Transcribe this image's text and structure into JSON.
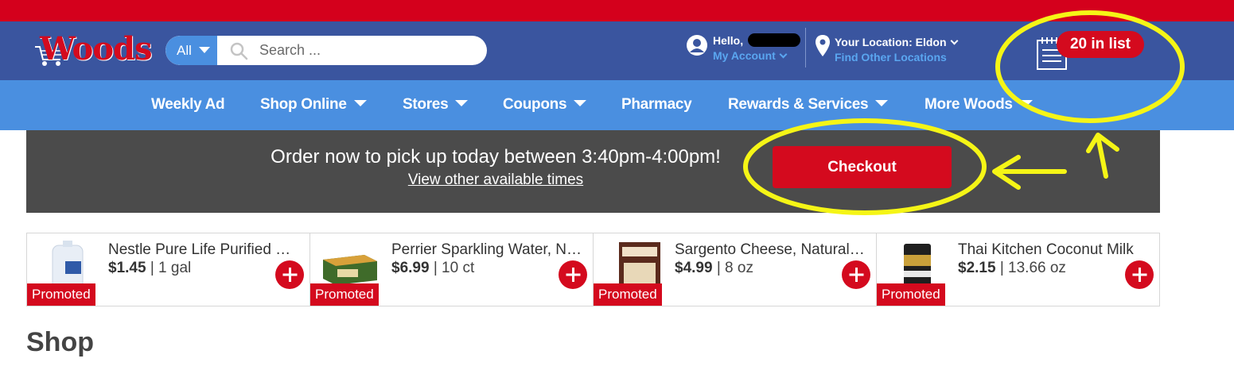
{
  "brand": {
    "logo_text": "Woods"
  },
  "colors": {
    "topbar": "#d4001c",
    "header": "#3a559f",
    "nav": "#4a8fe0",
    "banner": "#4b4b4b",
    "accent_red": "#d40a1e",
    "link_blue": "#5aa6f0",
    "annotation_yellow": "#f5f516"
  },
  "search": {
    "category": "All",
    "placeholder": "Search ...",
    "icon": "search-icon"
  },
  "account": {
    "hello": "Hello,",
    "link": "My Account"
  },
  "location": {
    "label": "Your Location: Eldon",
    "link": "Find Other Locations"
  },
  "list": {
    "badge": "20 in list",
    "icon": "list-icon"
  },
  "nav": {
    "items": [
      {
        "label": "Weekly Ad"
      },
      {
        "label": "Shop Online"
      },
      {
        "label": "Stores"
      },
      {
        "label": "Coupons"
      },
      {
        "label": "Pharmacy"
      },
      {
        "label": "Rewards & Services"
      },
      {
        "label": "More Woods"
      }
    ]
  },
  "banner": {
    "message": "Order now to pick up today between 3:40pm-4:00pm!",
    "link": "View other available times",
    "checkout": "Checkout"
  },
  "products": [
    {
      "name": "Nestle Pure Life Purified Water",
      "price": "$1.45",
      "size": "| 1 gal",
      "badge": "Promoted"
    },
    {
      "name": "Perrier Sparkling Water, Natural",
      "price": "$6.99",
      "size": "| 10 ct",
      "badge": "Promoted"
    },
    {
      "name": "Sargento Cheese, Natural Provolone",
      "price": "$4.99",
      "size": "| 8 oz",
      "badge": "Promoted"
    },
    {
      "name": "Thai Kitchen Coconut Milk",
      "price": "$2.15",
      "size": "| 13.66 oz",
      "badge": "Promoted"
    }
  ],
  "shop": {
    "title": "Shop"
  }
}
